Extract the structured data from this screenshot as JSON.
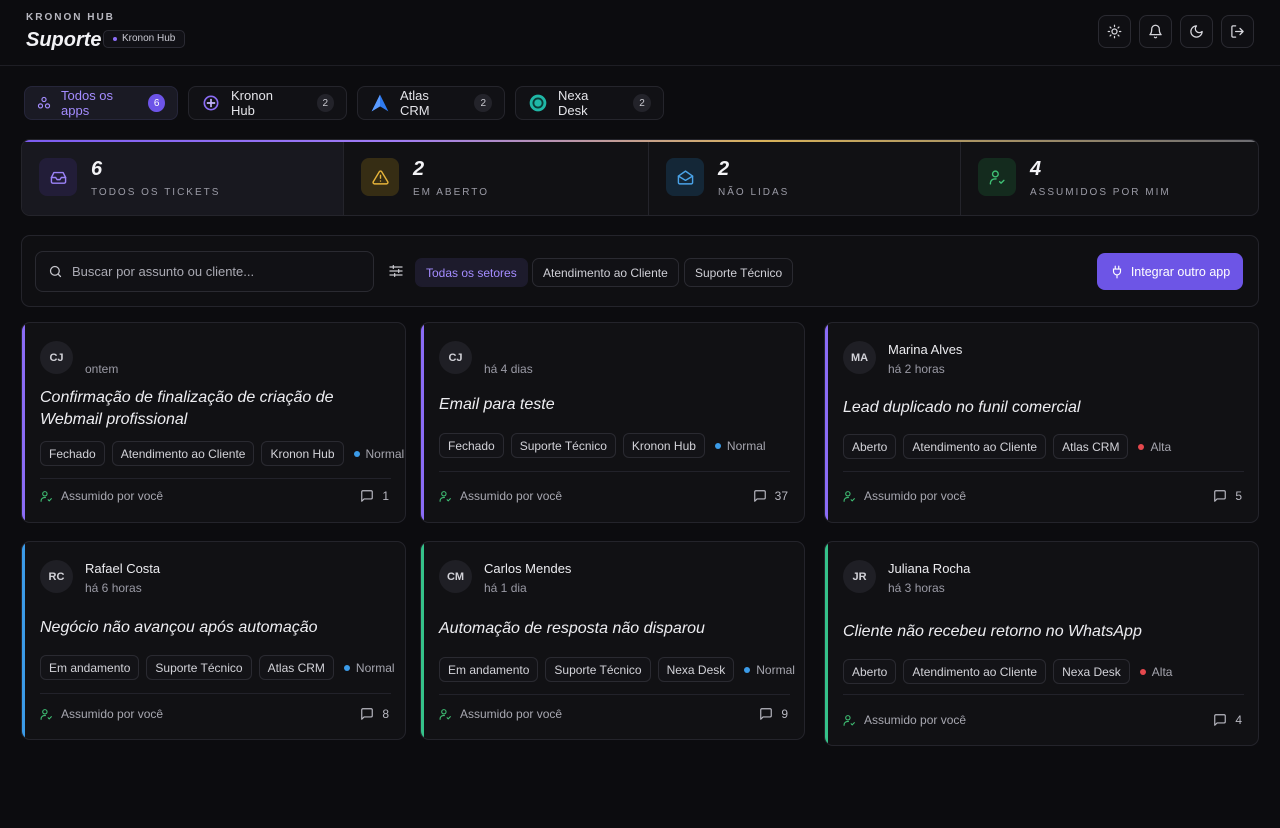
{
  "header": {
    "brand_small": "KRONON HUB",
    "title": "Suporte",
    "badge": "Kronon Hub",
    "icons": [
      "sun-icon",
      "bell-icon",
      "moon-icon",
      "logout-icon"
    ]
  },
  "app_tabs": [
    {
      "label": "Todos os apps",
      "count": "6",
      "icon": "apps-icon",
      "active": true
    },
    {
      "label": "Kronon Hub",
      "count": "2",
      "icon": "kronon-logo-icon",
      "active": false
    },
    {
      "label": "Atlas CRM",
      "count": "2",
      "icon": "atlas-logo-icon",
      "active": false
    },
    {
      "label": "Nexa Desk",
      "count": "2",
      "icon": "nexa-logo-icon",
      "active": false
    }
  ],
  "stats": [
    {
      "value": "6",
      "label": "TODOS OS TICKETS",
      "icon": "inbox-icon",
      "color": "#8b6cf6"
    },
    {
      "value": "2",
      "label": "EM ABERTO",
      "icon": "warning-icon",
      "color": "#e5b33a"
    },
    {
      "value": "2",
      "label": "NÃO LIDAS",
      "icon": "mail-open-icon",
      "color": "#4aa3e8"
    },
    {
      "value": "4",
      "label": "ASSUMIDOS POR MIM",
      "icon": "user-check-icon",
      "color": "#3fbf74"
    }
  ],
  "filters": {
    "search_placeholder": "Buscar por assunto ou cliente...",
    "sectors": [
      "Todas os setores",
      "Atendimento ao Cliente",
      "Suporte Técnico"
    ],
    "active_sector": "Todas os setores",
    "integrate_label": "Integrar outro app"
  },
  "colors": {
    "accent": "#6d55e6",
    "purple": "#8b6cf6",
    "blue": "#3b9be8",
    "green": "#35c28a",
    "prio_normal": "#3b9be8",
    "prio_alta": "#e5484d"
  },
  "tickets": [
    {
      "initials": "CJ",
      "name": "",
      "time": "ontem",
      "title": "Confirmação de finalização de criação de Webmail profissional",
      "status": "Fechado",
      "sector": "Atendimento ao Cliente",
      "app": "Kronon Hub",
      "priority": "Normal",
      "assigned": "Assumido por você",
      "comments": "1"
    },
    {
      "initials": "CJ",
      "name": "",
      "time": "há 4 dias",
      "title": "Email para teste",
      "status": "Fechado",
      "sector": "Suporte Técnico",
      "app": "Kronon Hub",
      "priority": "Normal",
      "assigned": "Assumido por você",
      "comments": "37"
    },
    {
      "initials": "MA",
      "name": "Marina Alves",
      "time": "há 2 horas",
      "title": "Lead duplicado no funil comercial",
      "status": "Aberto",
      "sector": "Atendimento ao Cliente",
      "app": "Atlas CRM",
      "priority": "Alta",
      "assigned": "Assumido por você",
      "comments": "5"
    },
    {
      "initials": "RC",
      "name": "Rafael Costa",
      "time": "há 6 horas",
      "title": "Negócio não avançou após automação",
      "status": "Em andamento",
      "sector": "Suporte Técnico",
      "app": "Atlas CRM",
      "priority": "Normal",
      "assigned": "Assumido por você",
      "comments": "8"
    },
    {
      "initials": "CM",
      "name": "Carlos Mendes",
      "time": "há 1 dia",
      "title": "Automação de resposta não disparou",
      "status": "Em andamento",
      "sector": "Suporte Técnico",
      "app": "Nexa Desk",
      "priority": "Normal",
      "assigned": "Assumido por você",
      "comments": "9"
    },
    {
      "initials": "JR",
      "name": "Juliana Rocha",
      "time": "há 3 horas",
      "title": "Cliente não recebeu retorno no WhatsApp",
      "status": "Aberto",
      "sector": "Atendimento ao Cliente",
      "app": "Nexa Desk",
      "priority": "Alta",
      "assigned": "Assumido por você",
      "comments": "4"
    }
  ]
}
